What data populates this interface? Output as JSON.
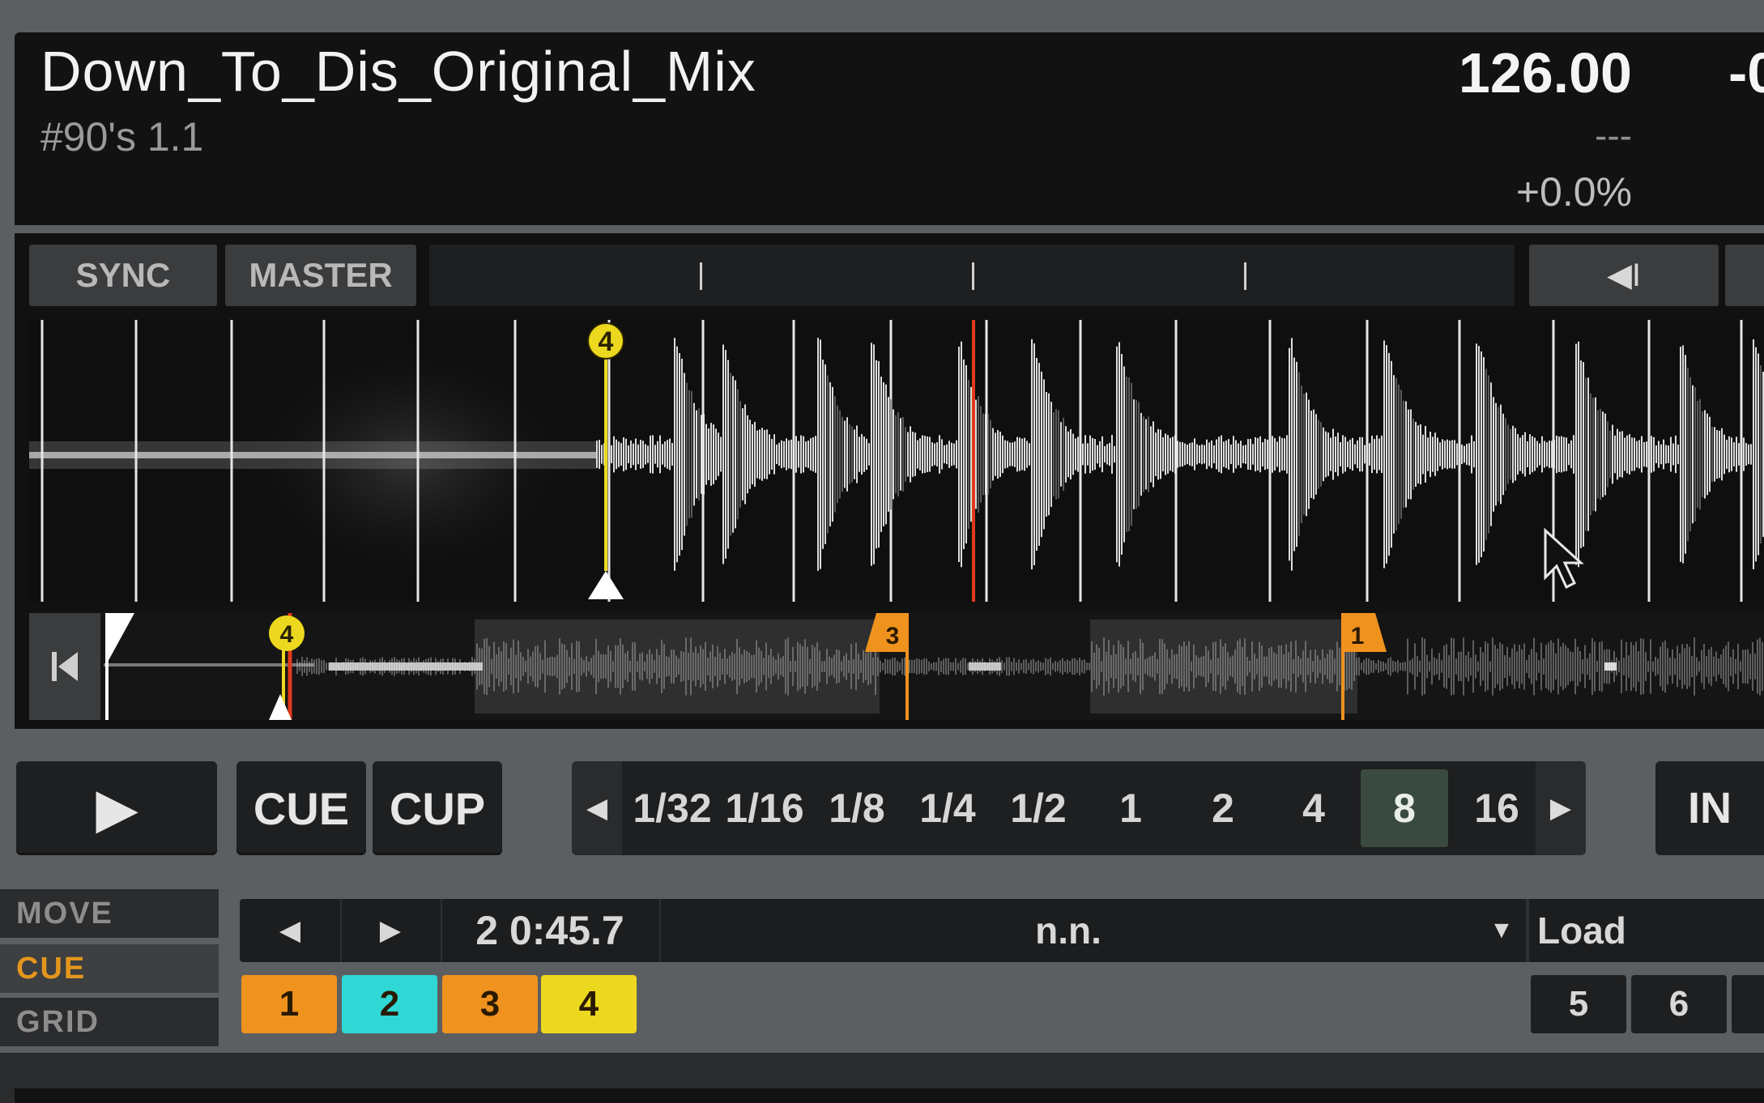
{
  "track": {
    "title": "Down_To_Dis_Original_Mix",
    "artist": "#90's 1.1",
    "bpm": "126.00",
    "key": "---",
    "tempo": "+0.0%",
    "time_right": "-0"
  },
  "sync": {
    "sync_label": "SYNC",
    "master_label": "MASTER",
    "nudge_icon": "◀I"
  },
  "transport": {
    "play_icon": "▶",
    "cue_label": "CUE",
    "cup_label": "CUP"
  },
  "loop": {
    "prev_icon": "◀",
    "next_icon": "▶",
    "sizes": [
      "1/32",
      "1/16",
      "1/8",
      "1/4",
      "1/2",
      "1",
      "2",
      "4",
      "8",
      "16"
    ],
    "active_size": "8",
    "in_label": "IN"
  },
  "modes": {
    "move": "MOVE",
    "cue": "CUE",
    "grid": "GRID"
  },
  "cue_nav": {
    "prev_icon": "◀",
    "next_icon": "▶",
    "position": "2 0:45.7",
    "name": "n.n.",
    "dropdown_icon": "▼",
    "load_label": "Load"
  },
  "hotcues": [
    {
      "label": "1",
      "color": "#f0921e"
    },
    {
      "label": "2",
      "color": "#2fd8d4"
    },
    {
      "label": "3",
      "color": "#f0921e"
    },
    {
      "label": "4",
      "color": "#ecd81e"
    },
    {
      "label": "5",
      "color": ""
    },
    {
      "label": "6",
      "color": ""
    }
  ],
  "markers": {
    "main_cue_label": "4",
    "overview_cue_labels": [
      "4",
      "3",
      "1"
    ]
  },
  "colors": {
    "cue_orange": "#f0921e",
    "cue_yellow": "#ecd81e",
    "cue_cyan": "#2fd8d4",
    "playhead_red": "#e0391c"
  }
}
